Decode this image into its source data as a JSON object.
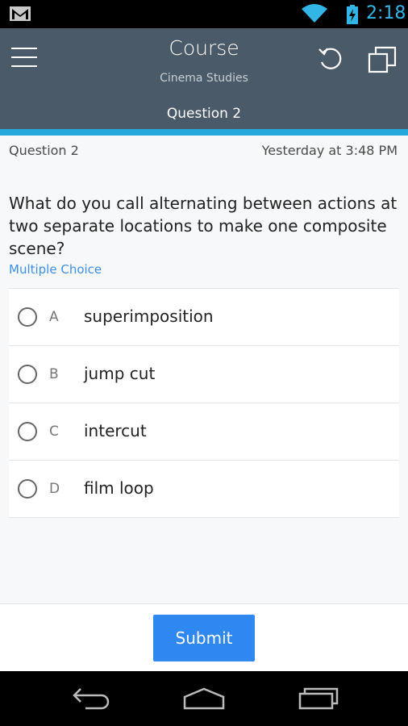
{
  "status_bar": {
    "time": "2:18",
    "icons": [
      "gmail-icon",
      "wifi-icon",
      "battery-charging-icon"
    ],
    "time_color": "#33b5e5"
  },
  "header": {
    "title": "Course",
    "subtitle": "Cinema Studies",
    "tab_label": "Question 2",
    "background": "#4a5a68",
    "accent": "#25a9dc",
    "icons": [
      "menu-icon",
      "refresh-icon",
      "windows-icon"
    ]
  },
  "question": {
    "number_label": "Question 2",
    "timestamp": "Yesterday at 3:48 PM",
    "text": "What do you call alternating between actions at two separate locations to make one composite scene?",
    "type": "Multiple Choice",
    "options": [
      {
        "letter": "A",
        "text": "superimposition",
        "selected": false
      },
      {
        "letter": "B",
        "text": "jump cut",
        "selected": false
      },
      {
        "letter": "C",
        "text": "intercut",
        "selected": false
      },
      {
        "letter": "D",
        "text": "film loop",
        "selected": false
      }
    ]
  },
  "footer": {
    "submit_label": "Submit",
    "submit_color": "#2f87f0"
  },
  "nav_bar": {
    "icons": [
      "back-icon",
      "home-icon",
      "recents-icon"
    ]
  }
}
